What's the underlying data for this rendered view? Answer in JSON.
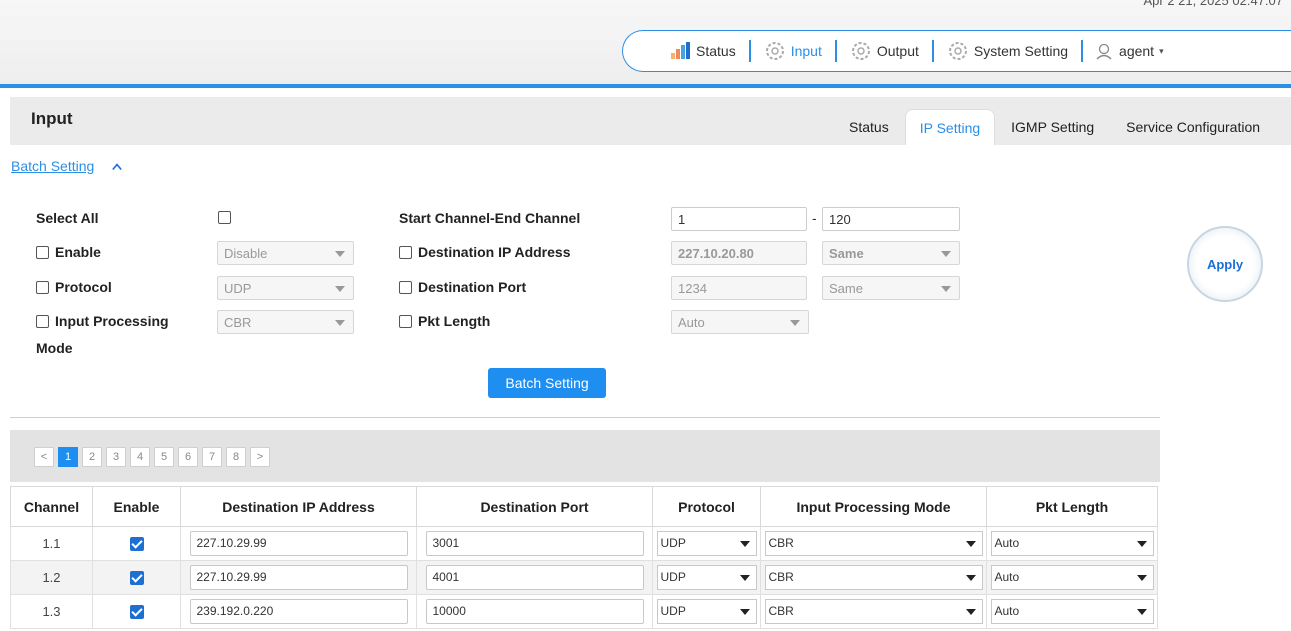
{
  "header": {
    "datetime": "Apr 2 21, 2025 02:47:07",
    "nav": {
      "status": "Status",
      "input": "Input",
      "output": "Output",
      "system_setting": "System Setting",
      "user": "agent"
    }
  },
  "page": {
    "title": "Input",
    "tabs": [
      "Status",
      "IP Setting",
      "IGMP Setting",
      "Service Configuration"
    ],
    "active_tab": "IP Setting"
  },
  "batch": {
    "link_label": "Batch Setting",
    "select_all_label": "Select All",
    "enable_label": "Enable",
    "enable_value": "Disable",
    "protocol_label": "Protocol",
    "protocol_value": "UDP",
    "input_processing_label": "Input Processing",
    "input_processing_label2": "Mode",
    "input_processing_value": "CBR",
    "start_end_label": "Start Channel-End Channel",
    "start_channel": "1",
    "end_channel": "120",
    "dash": "-",
    "dest_ip_label": "Destination IP Address",
    "dest_ip_value": "227.10.20.80",
    "dest_ip_mode": "Same",
    "dest_port_label": "Destination Port",
    "dest_port_value": "1234",
    "dest_port_mode": "Same",
    "pkt_length_label": "Pkt Length",
    "pkt_length_value": "Auto",
    "batch_button": "Batch Setting",
    "apply_button": "Apply"
  },
  "pager": {
    "prev": "<",
    "next": ">",
    "pages": [
      "1",
      "2",
      "3",
      "4",
      "5",
      "6",
      "7",
      "8"
    ],
    "active": "1"
  },
  "table": {
    "headers": [
      "Channel",
      "Enable",
      "Destination IP Address",
      "Destination Port",
      "Protocol",
      "Input Processing Mode",
      "Pkt Length"
    ],
    "rows": [
      {
        "channel": "1.1",
        "enabled": true,
        "ip": "227.10.29.99",
        "port": "3001",
        "protocol": "UDP",
        "mode": "CBR",
        "pkt": "Auto"
      },
      {
        "channel": "1.2",
        "enabled": true,
        "ip": "227.10.29.99",
        "port": "4001",
        "protocol": "UDP",
        "mode": "CBR",
        "pkt": "Auto"
      },
      {
        "channel": "1.3",
        "enabled": true,
        "ip": "239.192.0.220",
        "port": "10000",
        "protocol": "UDP",
        "mode": "CBR",
        "pkt": "Auto"
      }
    ]
  },
  "colors": {
    "accent": "#2b8fe6",
    "button": "#1e8ef0"
  },
  "icons": [
    "status-chart-icon",
    "gear-icon",
    "user-icon",
    "chevron-up-icon",
    "chevron-down-icon"
  ]
}
